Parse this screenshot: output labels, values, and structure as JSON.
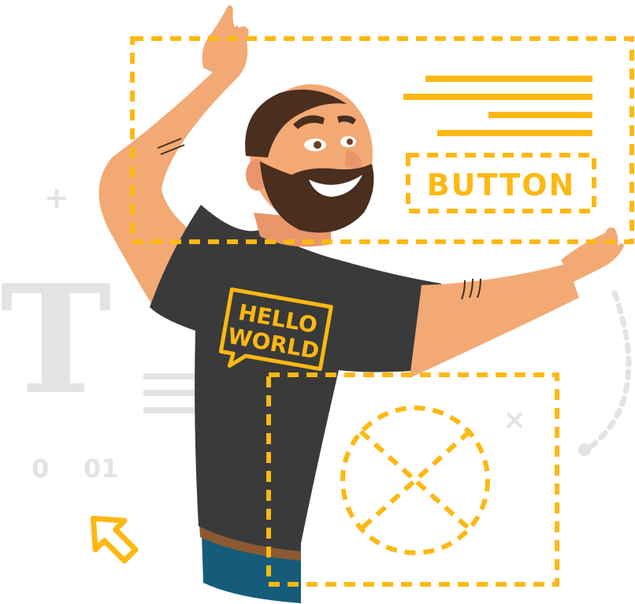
{
  "illustration": {
    "button_label": "BUTTON",
    "shirt_text_line1": "HELLO",
    "shirt_text_line2": "WORLD",
    "deco_zero": "0",
    "deco_zero_one": "01",
    "deco_letter": "T",
    "deco_plus": "+",
    "deco_cross": "×"
  },
  "colors": {
    "accent": "#FDB813",
    "skin": "#F2A974",
    "shirt": "#3A3A3A",
    "beard": "#4A2E1E",
    "deco_gray": "#E3E3E3"
  }
}
